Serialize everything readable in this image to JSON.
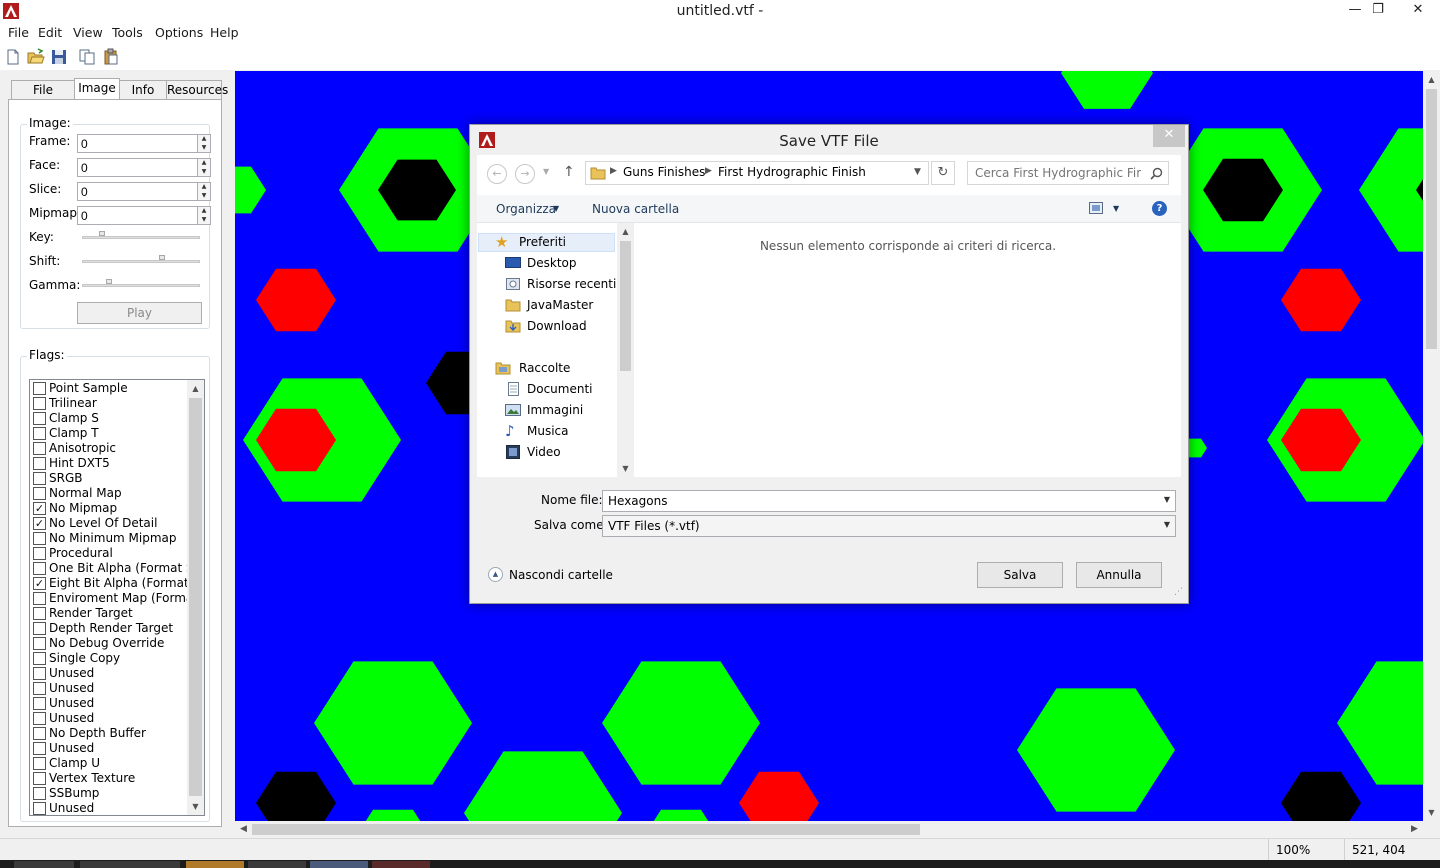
{
  "window": {
    "title": "untitled.vtf -",
    "minimize": "—",
    "maximize": "❐",
    "close": "✕"
  },
  "menu": [
    "File",
    "Edit",
    "View",
    "Tools",
    "Options",
    "Help"
  ],
  "tabs": [
    "File System",
    "Image",
    "Info",
    "Resources"
  ],
  "image_group": {
    "title": "Image:",
    "frame_label": "Frame:",
    "frame_value": "0",
    "face_label": "Face:",
    "face_value": "0",
    "slice_label": "Slice:",
    "slice_value": "0",
    "mipmap_label": "Mipmap:",
    "mipmap_value": "0",
    "key_label": "Key:",
    "shift_label": "Shift:",
    "gamma_label": "Gamma:",
    "play_label": "Play"
  },
  "flags_group": {
    "title": "Flags:",
    "items": [
      {
        "label": "Point Sample",
        "checked": false
      },
      {
        "label": "Trilinear",
        "checked": false
      },
      {
        "label": "Clamp S",
        "checked": false
      },
      {
        "label": "Clamp T",
        "checked": false
      },
      {
        "label": "Anisotropic",
        "checked": false
      },
      {
        "label": "Hint DXT5",
        "checked": false
      },
      {
        "label": "SRGB",
        "checked": false
      },
      {
        "label": "Normal Map",
        "checked": false
      },
      {
        "label": "No Mipmap",
        "checked": true
      },
      {
        "label": "No Level Of Detail",
        "checked": true
      },
      {
        "label": "No Minimum Mipmap",
        "checked": false
      },
      {
        "label": "Procedural",
        "checked": false
      },
      {
        "label": "One Bit Alpha (Format Spec",
        "checked": false
      },
      {
        "label": "Eight Bit Alpha (Format Spe",
        "checked": true
      },
      {
        "label": "Enviroment Map (Format Sp",
        "checked": false
      },
      {
        "label": "Render Target",
        "checked": false
      },
      {
        "label": "Depth Render Target",
        "checked": false
      },
      {
        "label": "No Debug Override",
        "checked": false
      },
      {
        "label": "Single Copy",
        "checked": false
      },
      {
        "label": "Unused",
        "checked": false
      },
      {
        "label": "Unused",
        "checked": false
      },
      {
        "label": "Unused",
        "checked": false
      },
      {
        "label": "Unused",
        "checked": false
      },
      {
        "label": "No Depth Buffer",
        "checked": false
      },
      {
        "label": "Unused",
        "checked": false
      },
      {
        "label": "Clamp U",
        "checked": false
      },
      {
        "label": "Vertex Texture",
        "checked": false
      },
      {
        "label": "SSBump",
        "checked": false
      },
      {
        "label": "Unused",
        "checked": false
      }
    ]
  },
  "canvas_colors": {
    "background": "#0000ff",
    "green": "#00ff00",
    "red": "#ff0000",
    "black": "#000000"
  },
  "status": {
    "zoom": "100%",
    "coords": "521, 404"
  },
  "dialog": {
    "title": "Save VTF File",
    "breadcrumb": [
      "Guns Finishes",
      "First Hydrographic Finish"
    ],
    "search_placeholder": "Cerca First Hydrographic Finish",
    "organize_label": "Organizza",
    "new_folder_label": "Nuova cartella",
    "empty_message": "Nessun elemento corrisponde ai criteri di ricerca.",
    "nav": {
      "favorites_label": "Preferiti",
      "favorites": [
        "Desktop",
        "Risorse recenti",
        "JavaMaster",
        "Download"
      ],
      "libraries_label": "Raccolte",
      "libraries": [
        "Documenti",
        "Immagini",
        "Musica",
        "Video"
      ]
    },
    "filename_label": "Nome file:",
    "filename_value": "Hexagons",
    "savetype_label": "Salva come:",
    "savetype_value": "VTF Files (*.vtf)",
    "hide_folders_label": "Nascondi cartelle",
    "save_label": "Salva",
    "cancel_label": "Annulla"
  }
}
